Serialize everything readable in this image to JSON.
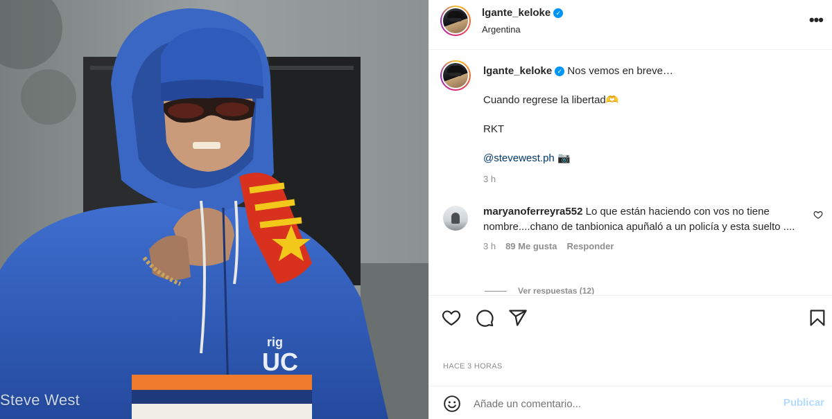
{
  "photo": {
    "watermark": "Steve West",
    "icon": "post-photo"
  },
  "header": {
    "username": "lgante_keloke",
    "verified_icon": "verified-badge-icon",
    "location": "Argentina",
    "more_icon": "more-options-icon"
  },
  "caption": {
    "username": "lgante_keloke",
    "text": "Nos vemos en breve…",
    "line2": "Cuando regrese la libertad🫶",
    "line3": "RKT",
    "mention": "@stevewest.ph",
    "camera": "📷",
    "time": "3 h"
  },
  "comment": {
    "username": "maryanoferreyra552",
    "text": "Lo que están haciendo con vos no tiene nombre....chano de tanbionica apuñaló a un policía y esta suelto ....",
    "time": "3 h",
    "likes": "89 Me gusta",
    "reply": "Responder",
    "view_replies": "Ver respuestas (12)"
  },
  "actions": {
    "like_icon": "heart-icon",
    "comment_icon": "comment-icon",
    "share_icon": "share-icon",
    "save_icon": "bookmark-icon"
  },
  "post_date": "HACE 3 HORAS",
  "add_comment": {
    "placeholder": "Añade un comentario...",
    "post_label": "Publicar",
    "emoji_icon": "emoji-icon"
  },
  "colors": {
    "link": "#00376b",
    "verified": "#0095f6",
    "secondary_text": "#8e8e8e",
    "post_button_disabled": "#b3dbff"
  }
}
